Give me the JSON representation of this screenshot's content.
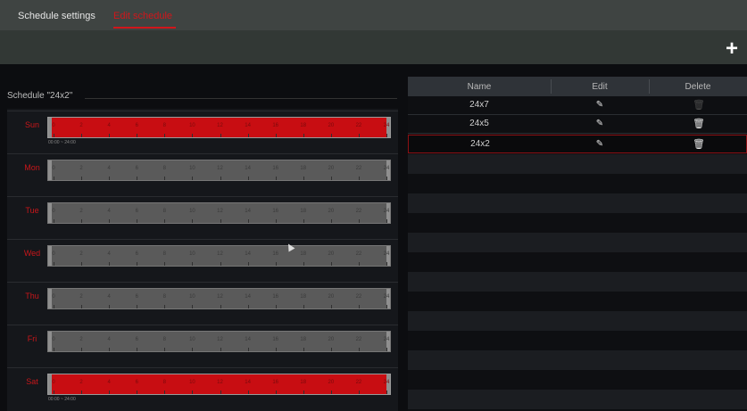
{
  "tabs": [
    {
      "label": "Schedule settings",
      "active": false
    },
    {
      "label": "Edit schedule",
      "active": true
    }
  ],
  "toolbar": {
    "add_icon": "plus-icon"
  },
  "schedule": {
    "title": "Schedule \"24x2\"",
    "days": [
      {
        "label": "Sun",
        "active": true,
        "range": "00:00 ~ 24:00"
      },
      {
        "label": "Mon",
        "active": false,
        "range": ""
      },
      {
        "label": "Tue",
        "active": false,
        "range": ""
      },
      {
        "label": "Wed",
        "active": false,
        "range": ""
      },
      {
        "label": "Thu",
        "active": false,
        "range": ""
      },
      {
        "label": "Fri",
        "active": false,
        "range": ""
      },
      {
        "label": "Sat",
        "active": true,
        "range": "00:00 ~ 24:00"
      }
    ],
    "hour_ticks": [
      "0",
      "2",
      "4",
      "6",
      "8",
      "10",
      "12",
      "14",
      "16",
      "18",
      "20",
      "22",
      "24"
    ]
  },
  "list": {
    "headers": {
      "name": "Name",
      "edit": "Edit",
      "delete": "Delete"
    },
    "rows": [
      {
        "name": "24x7",
        "edit_icon": "pencil-icon",
        "delete_icon": "trash-icon",
        "delete_enabled": false
      },
      {
        "name": "24x5",
        "edit_icon": "pencil-icon",
        "delete_icon": "trash-icon",
        "delete_enabled": true
      },
      {
        "name": "24x2",
        "edit_icon": "pencil-icon",
        "delete_icon": "trash-icon",
        "delete_enabled": true,
        "selected": true
      }
    ]
  },
  "colors": {
    "accent": "#d0161b",
    "active_bar": "#c80d12",
    "inactive_bar": "#5a5a5a"
  }
}
